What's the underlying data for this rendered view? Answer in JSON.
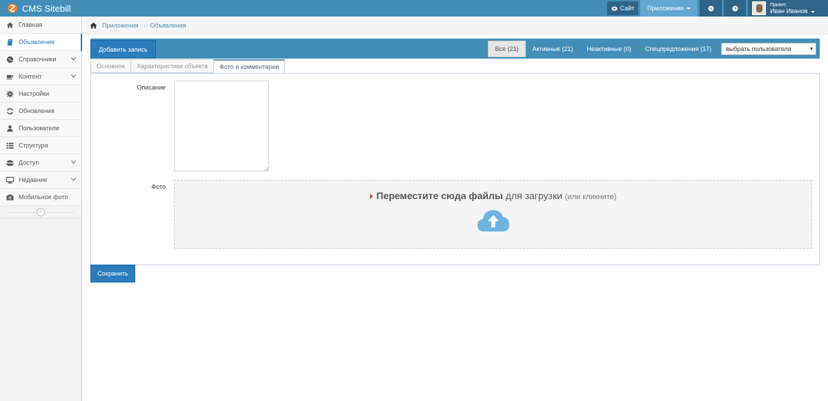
{
  "app": {
    "title": "CMS Sitebill"
  },
  "navbar": {
    "site_label": "Сайт",
    "apps_label": "Приложения",
    "user": {
      "greeting": "Привет,",
      "name": "Иван Иванов"
    }
  },
  "sidebar": {
    "items": [
      {
        "label": "Главная",
        "icon": "home-icon"
      },
      {
        "label": "Объявления",
        "icon": "book-icon",
        "active": true
      },
      {
        "label": "Справочники",
        "icon": "globe-icon",
        "expandable": true
      },
      {
        "label": "Контент",
        "icon": "coffee-icon",
        "expandable": true
      },
      {
        "label": "Настройки",
        "icon": "gear-icon"
      },
      {
        "label": "Обновления",
        "icon": "refresh-icon"
      },
      {
        "label": "Пользователи",
        "icon": "user-icon"
      },
      {
        "label": "Структура",
        "icon": "list-icon"
      },
      {
        "label": "Доступ",
        "icon": "users-icon",
        "expandable": true
      },
      {
        "label": "Недавние",
        "icon": "desktop-icon",
        "expandable": true
      },
      {
        "label": "Мобильное фото",
        "icon": "camera-icon"
      }
    ]
  },
  "breadcrumb": {
    "items": [
      "Приложения",
      "Объявления"
    ]
  },
  "toolbar": {
    "add_label": "Добавить запись",
    "filters": [
      {
        "label": "Все (21)",
        "selected": true
      },
      {
        "label": "Активные (21)"
      },
      {
        "label": "Неактивные (0)"
      },
      {
        "label": "Спецпредложения (17)"
      }
    ],
    "user_select": "выбрать пользователя"
  },
  "tabs": [
    {
      "label": "Основное"
    },
    {
      "label": "Характеристики объекта"
    },
    {
      "label": "Фото и комментарии",
      "active": true
    }
  ],
  "form": {
    "description_label": "Описание",
    "photo_label": "Фото",
    "dropzone": {
      "bold": "Переместите сюда файлы",
      "normal": "для загрузки",
      "small": "(или кликните)"
    },
    "save_label": "Сохранить"
  },
  "colors": {
    "navbar": "#438eb9",
    "primary_button": "#2b7dbc",
    "link": "#4c8fbd",
    "upload_icon": "#6fb3e0"
  }
}
